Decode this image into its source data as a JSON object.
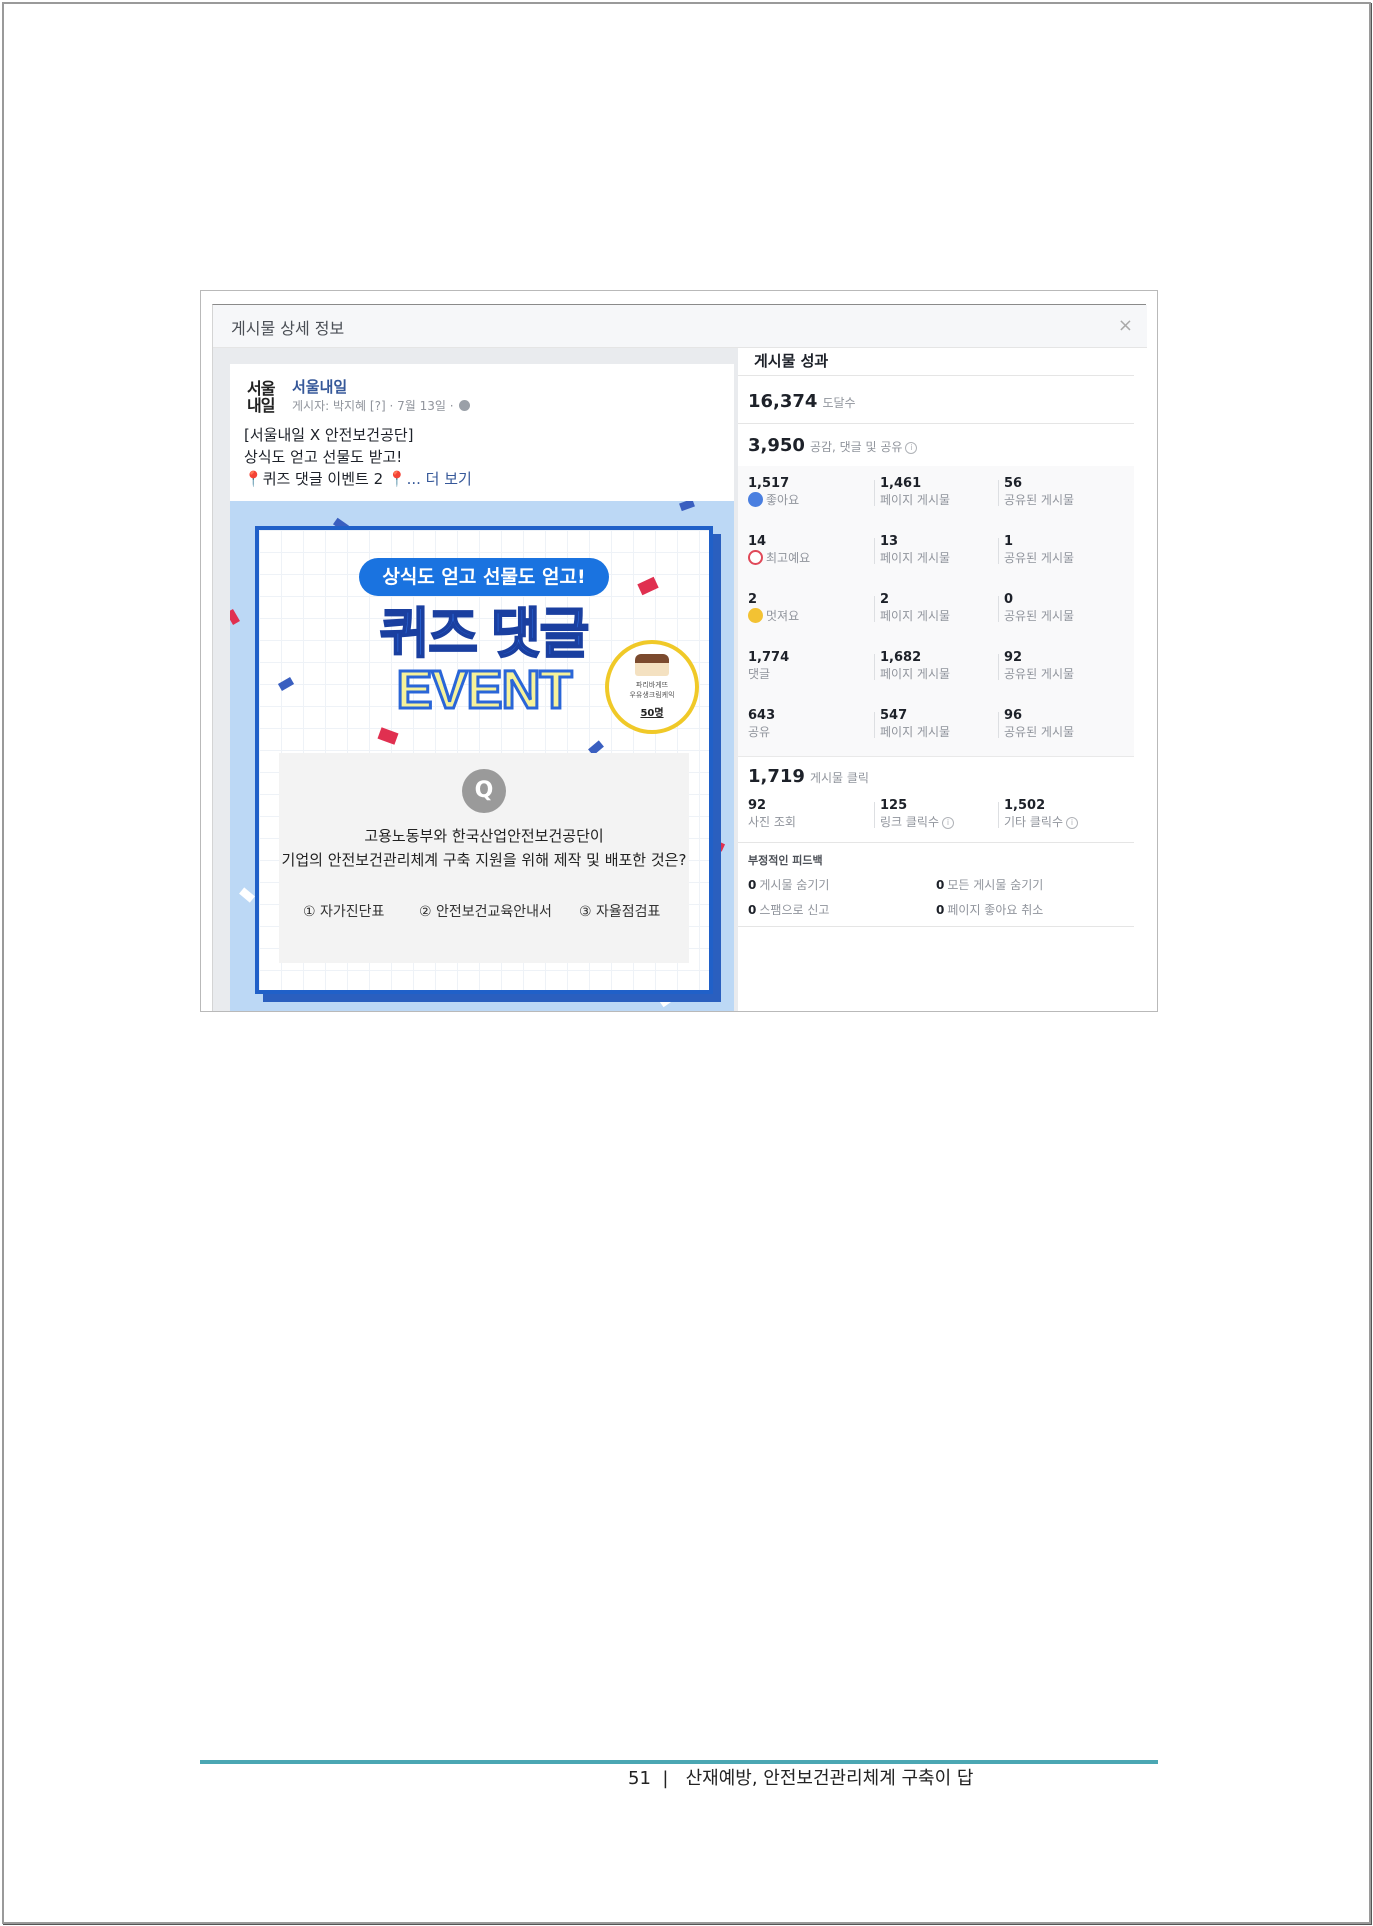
{
  "dialog": {
    "title": "게시물 상세 정보",
    "close": "×"
  },
  "post": {
    "logo_line1": "서울",
    "logo_line2": "내일",
    "page_name": "서울내일",
    "meta": "게시자: 박지혜 [?] · 7월 13일 ·",
    "text_line1": "[서울내일 X 안전보건공단]",
    "text_line2": "상식도 얻고 선물도 받고!",
    "text_line3": "퀴즈 댓글 이벤트 2",
    "more": "... 더 보기",
    "image": {
      "pill": "상식도 얻고 선물도 얻고!",
      "title1": "퀴즈 댓글",
      "title2": "EVENT",
      "bubble_text1": "파리바게뜨",
      "bubble_text2": "우유생크림케익",
      "bubble_count": "50명",
      "q_mark": "Q",
      "question1": "고용노동부와 한국산업안전보건공단이",
      "question2": "기업의 안전보건관리체계 구축 지원을 위해 제작 및 배포한 것은?",
      "options": [
        "① 자가진단표",
        "② 안전보건교육안내서",
        "③ 자율점검표"
      ]
    }
  },
  "performance": {
    "title": "게시물 성과",
    "reach": {
      "value": "16,374",
      "label": "도달수"
    },
    "engagement": {
      "value": "3,950",
      "label": "공감, 댓글 및 공유"
    },
    "rows": [
      {
        "total": "1,517",
        "label": "좋아요",
        "icon": "like-icon",
        "page": "1,461",
        "page_label": "페이지 게시물",
        "shared": "56",
        "shared_label": "공유된 게시물"
      },
      {
        "total": "14",
        "label": "최고예요",
        "icon": "love-icon",
        "page": "13",
        "page_label": "페이지 게시물",
        "shared": "1",
        "shared_label": "공유된 게시물"
      },
      {
        "total": "2",
        "label": "멋져요",
        "icon": "wow-icon",
        "page": "2",
        "page_label": "페이지 게시물",
        "shared": "0",
        "shared_label": "공유된 게시물"
      },
      {
        "total": "1,774",
        "label": "댓글",
        "icon": "",
        "page": "1,682",
        "page_label": "페이지 게시물",
        "shared": "92",
        "shared_label": "공유된 게시물"
      },
      {
        "total": "643",
        "label": "공유",
        "icon": "",
        "page": "547",
        "page_label": "페이지 게시물",
        "shared": "96",
        "shared_label": "공유된 게시물"
      }
    ],
    "clicks": {
      "value": "1,719",
      "label": "게시물 클릭",
      "photo": {
        "value": "92",
        "label": "사진 조회"
      },
      "link": {
        "value": "125",
        "label": "링크 클릭수"
      },
      "other": {
        "value": "1,502",
        "label": "기타 클릭수"
      }
    },
    "negative": {
      "title": "부정적인 피드백",
      "hide_post": {
        "value": "0",
        "label": "게시물 숨기기"
      },
      "hide_all": {
        "value": "0",
        "label": "모든 게시물 숨기기"
      },
      "spam": {
        "value": "0",
        "label": "스팸으로 신고"
      },
      "unlike": {
        "value": "0",
        "label": "페이지 좋아요 취소"
      }
    }
  },
  "footer": {
    "page_number": "51",
    "separator": "|",
    "title": "산재예방, 안전보건관리체계 구축이 답"
  }
}
